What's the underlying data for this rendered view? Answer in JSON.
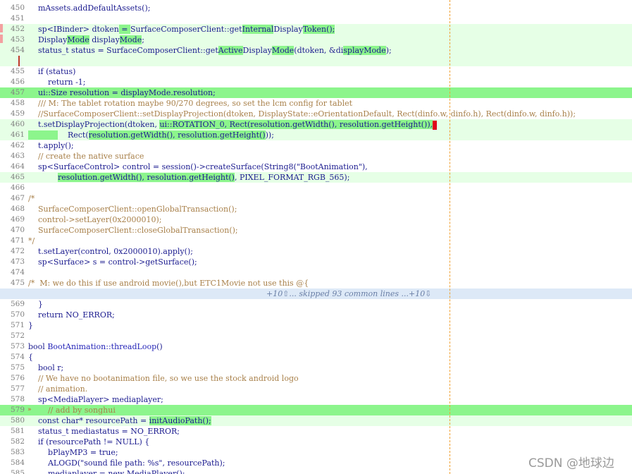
{
  "watermark": "CSDN @地球边",
  "separator": "+10⇧... skipped 93 common lines ...+10⇩",
  "lines": [
    {
      "n": "450",
      "bg": "",
      "segs": [
        {
          "t": "    mAssets.addDefaultAssets();"
        }
      ]
    },
    {
      "n": "451",
      "bg": "",
      "segs": []
    },
    {
      "n": "452",
      "bg": "add",
      "segs": [
        {
          "t": "    sp<IBinder> dtoken"
        },
        {
          "t": " = ",
          "h": 1
        },
        {
          "t": "SurfaceComposerClient::get"
        },
        {
          "t": "Internal",
          "h": 1
        },
        {
          "t": "Display"
        },
        {
          "t": "Token();",
          "h": 1
        }
      ]
    },
    {
      "n": "453",
      "bg": "add",
      "segs": [
        {
          "t": "    Display"
        },
        {
          "t": "Mode",
          "h": 1
        },
        {
          "t": " display"
        },
        {
          "t": "Mode",
          "h": 1
        },
        {
          "t": ";"
        }
      ]
    },
    {
      "n": "454",
      "bg": "add",
      "segs": [
        {
          "t": "    status_t status = SurfaceComposerClient::get"
        },
        {
          "t": "Active",
          "h": 1
        },
        {
          "t": "Display"
        },
        {
          "t": "Mode",
          "h": 1
        },
        {
          "t": "(dtoken, &di"
        },
        {
          "t": "splayMode",
          "h": 1
        },
        {
          "t": ");"
        }
      ]
    },
    {
      "n": "",
      "bg": "add",
      "redbar": true,
      "segs": []
    },
    {
      "n": "455",
      "bg": "",
      "segs": [
        {
          "t": "    if (status)"
        }
      ]
    },
    {
      "n": "456",
      "bg": "",
      "segs": [
        {
          "t": "        return -1;"
        }
      ]
    },
    {
      "n": "457",
      "bg": "strong",
      "segs": [
        {
          "t": "    ui::Size resolution = displayMode.resolution;"
        }
      ]
    },
    {
      "n": "458",
      "bg": "",
      "segs": [
        {
          "t": "    /// M: The tablet rotation maybe 90/270 degrees, so set the lcm config for tablet",
          "c": 1
        }
      ]
    },
    {
      "n": "459",
      "bg": "",
      "segs": [
        {
          "t": "    //SurfaceComposerClient::setDisplayProjection(dtoken, DisplayState::eOrientationDefault, Rect(dinfo.w, dinfo.h), Rect(dinfo.w, dinfo.h));",
          "c": 1
        }
      ]
    },
    {
      "n": "460",
      "bg": "add",
      "segs": [
        {
          "t": "    t.setDisplayProjection(dtoken, "
        },
        {
          "t": "ui::ROTATION_0, Rect(resolution.getWidth(), resolution.getHeight()),",
          "h": 1
        },
        {
          "red": 1
        }
      ]
    },
    {
      "n": "461",
      "bg": "add",
      "segs": [
        {
          "t": "            ",
          "h": 1
        },
        {
          "t": "    Rect("
        },
        {
          "t": "resolution.getWidth(), resolution.getHeight()",
          "h": 1
        },
        {
          "t": "));"
        }
      ]
    },
    {
      "n": "462",
      "bg": "",
      "segs": [
        {
          "t": "    t.apply();"
        }
      ]
    },
    {
      "n": "463",
      "bg": "",
      "segs": [
        {
          "t": "    // create the native surface",
          "c": 1
        }
      ]
    },
    {
      "n": "464",
      "bg": "",
      "segs": [
        {
          "t": "    sp<SurfaceControl> control = session()->createSurface(String8(\"BootAnimation\"),"
        }
      ]
    },
    {
      "n": "465",
      "bg": "add",
      "segs": [
        {
          "t": "            "
        },
        {
          "t": "resolution.getWidth(), resolution.getHeight()",
          "h": 1
        },
        {
          "t": ", PIXEL_FORMAT_RGB_565);"
        }
      ]
    },
    {
      "n": "466",
      "bg": "",
      "segs": []
    },
    {
      "n": "467",
      "bg": "",
      "segs": [
        {
          "t": "/*",
          "c": 1
        }
      ]
    },
    {
      "n": "468",
      "bg": "",
      "segs": [
        {
          "t": "    SurfaceComposerClient::openGlobalTransaction();",
          "c": 1
        }
      ]
    },
    {
      "n": "469",
      "bg": "",
      "segs": [
        {
          "t": "    control->setLayer(0x2000010);",
          "c": 1
        }
      ]
    },
    {
      "n": "470",
      "bg": "",
      "segs": [
        {
          "t": "    SurfaceComposerClient::closeGlobalTransaction();",
          "c": 1
        }
      ]
    },
    {
      "n": "471",
      "bg": "",
      "segs": [
        {
          "t": "*/",
          "c": 1
        }
      ]
    },
    {
      "n": "472",
      "bg": "",
      "segs": [
        {
          "t": "    t.setLayer(control, 0x2000010).apply();"
        }
      ]
    },
    {
      "n": "473",
      "bg": "",
      "segs": [
        {
          "t": "    sp<Surface> s = control->getSurface();"
        }
      ]
    },
    {
      "n": "474",
      "bg": "",
      "segs": []
    },
    {
      "n": "475",
      "bg": "",
      "segs": [
        {
          "t": "/*  M: we do this if use android movie(),but ETC1Movie not use this @{",
          "c": 1
        }
      ]
    },
    {
      "n": "",
      "bg": "sep",
      "sep": true,
      "segs": []
    },
    {
      "n": "569",
      "bg": "",
      "segs": [
        {
          "t": "    }"
        }
      ]
    },
    {
      "n": "570",
      "bg": "",
      "segs": [
        {
          "t": "    return NO_ERROR;"
        }
      ]
    },
    {
      "n": "571",
      "bg": "",
      "segs": [
        {
          "t": "}"
        }
      ]
    },
    {
      "n": "572",
      "bg": "",
      "segs": []
    },
    {
      "n": "573",
      "bg": "",
      "segs": [
        {
          "t": "bool "
        },
        {
          "t": "BootAnimation::threadLoop",
          "f": 1
        },
        {
          "t": "()"
        }
      ]
    },
    {
      "n": "574",
      "bg": "",
      "segs": [
        {
          "t": "{"
        }
      ]
    },
    {
      "n": "575",
      "bg": "",
      "segs": [
        {
          "t": "    bool r;"
        }
      ]
    },
    {
      "n": "576",
      "bg": "",
      "segs": [
        {
          "t": "    // We have no bootanimation file, so we use the stock android logo",
          "c": 1
        }
      ]
    },
    {
      "n": "577",
      "bg": "",
      "segs": [
        {
          "t": "    // animation.",
          "c": 1
        }
      ]
    },
    {
      "n": "578",
      "bg": "",
      "segs": [
        {
          "t": "    sp<MediaPlayer> mediaplayer;"
        }
      ]
    },
    {
      "n": "579",
      "bg": "strong",
      "marker": "»",
      "segs": [
        {
          "t": "        // add by songhui",
          "c": 1
        }
      ]
    },
    {
      "n": "580",
      "bg": "add",
      "segs": [
        {
          "t": "    const char* resourcePath = "
        },
        {
          "t": "initAudioPath();",
          "h": 1
        }
      ]
    },
    {
      "n": "581",
      "bg": "",
      "segs": [
        {
          "t": "    status_t mediastatus = NO_ERROR;"
        }
      ]
    },
    {
      "n": "582",
      "bg": "",
      "segs": [
        {
          "t": "    if (resourcePath != NULL) {"
        }
      ]
    },
    {
      "n": "583",
      "bg": "",
      "segs": [
        {
          "t": "        bPlayMP3 = true;"
        }
      ]
    },
    {
      "n": "584",
      "bg": "",
      "segs": [
        {
          "t": "        ALOGD(\"sound file path: %s\", resourcePath);"
        }
      ]
    },
    {
      "n": "585",
      "bg": "",
      "segs": [
        {
          "t": "        mediaplayer = new MediaPlayer();"
        }
      ]
    }
  ]
}
